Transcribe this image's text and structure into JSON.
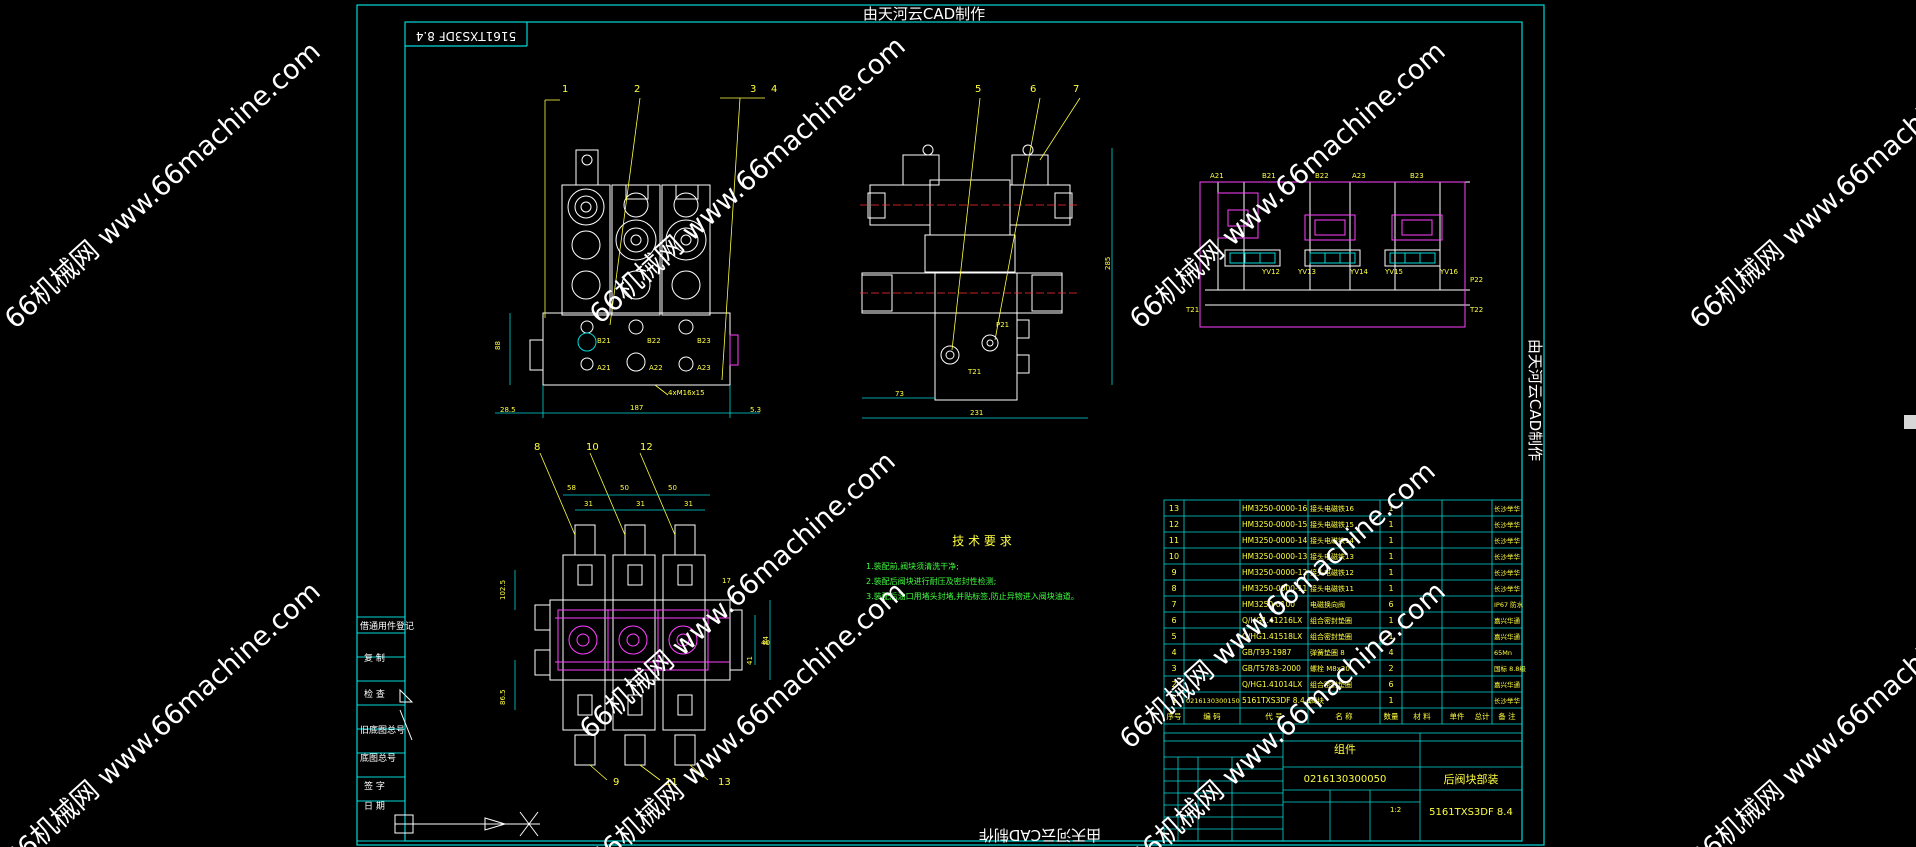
{
  "drawing": {
    "title_top": "由天河云CAD制作",
    "title_bottom": "由天河云CAD制作",
    "title_right": "由天河云CAD制作",
    "drawing_code_stamp": "5161TXS3DF 8.4"
  },
  "watermarks": [
    "66机械网 www.66machine.com",
    "66机械网 www.66machine.com",
    "66机械网 www.66machine.com",
    "66机械网 www.66machine.com",
    "66机械网 www.66machine.com",
    "66机械网 www.66machine.com",
    "66机械网 www.66machine.com",
    "66机械网 www.66machine.com",
    "66机械网 www.66machine.com",
    "66机械网 www.66machine.com"
  ],
  "left_strip": [
    "借通用件登记",
    "复 制",
    "检 查",
    "旧底图总号",
    "底图总号",
    "签 字",
    "日 期"
  ],
  "front_view": {
    "callouts": [
      "1",
      "2",
      "3",
      "4"
    ],
    "ports": [
      "B21",
      "B22",
      "B23",
      "A21",
      "A22",
      "A23"
    ],
    "bolt_label": "4xM16x15",
    "dims": [
      "28.5",
      "187",
      "5.3",
      "88"
    ]
  },
  "side_view": {
    "callouts": [
      "5",
      "6",
      "7"
    ],
    "ports": [
      "P21",
      "T21"
    ],
    "dims": [
      "73",
      "231",
      "285"
    ]
  },
  "top_view": {
    "callouts": [
      "8",
      "10",
      "12",
      "9",
      "11",
      "13"
    ],
    "dims": [
      "58",
      "31",
      "50",
      "31",
      "50",
      "31",
      "17",
      "84",
      "40",
      "41",
      "102.5",
      "86.5"
    ]
  },
  "hydraulic": {
    "ports_top": [
      "A21",
      "B21",
      "B22",
      "A23",
      "B23"
    ],
    "coils": [
      "YV12",
      "YV13",
      "YV14",
      "YV15",
      "YV16"
    ],
    "ports_side": [
      "P22",
      "T22",
      "T21"
    ]
  },
  "tech_req": {
    "title": "技 术 要 求",
    "lines": [
      "1.装配前,阀块须清洗干净;",
      "2.装配后阀块进行耐压及密封性检测;",
      "3.装配后油口用堵头封堵,并贴标签,防止异物进入阀块油道。"
    ]
  },
  "bom": {
    "rows": [
      {
        "no": "13",
        "code": "",
        "std": "HM3250-0000-16",
        "name": "接头电磁铁16",
        "qty": "1",
        "note": "长沙举华"
      },
      {
        "no": "12",
        "code": "",
        "std": "HM3250-0000-15",
        "name": "接头电磁铁15",
        "qty": "1",
        "note": "长沙举华"
      },
      {
        "no": "11",
        "code": "",
        "std": "HM3250-0000-14",
        "name": "接头电磁铁14",
        "qty": "1",
        "note": "长沙举华"
      },
      {
        "no": "10",
        "code": "",
        "std": "HM3250-0000-13",
        "name": "接头电磁铁13",
        "qty": "1",
        "note": "长沙举华"
      },
      {
        "no": "9",
        "code": "",
        "std": "HM3250-0000-12",
        "name": "接头电磁铁12",
        "qty": "1",
        "note": "长沙举华"
      },
      {
        "no": "8",
        "code": "",
        "std": "HM3250-0000-11",
        "name": "接头电磁铁11",
        "qty": "1",
        "note": "长沙举华"
      },
      {
        "no": "7",
        "code": "",
        "std": "HM3250-0100",
        "name": "电磁换向阀",
        "qty": "6",
        "note": "IP67 防水"
      },
      {
        "no": "6",
        "code": "",
        "std": "Q/HG1.41216LX",
        "name": "组合密封垫圈",
        "qty": "1",
        "note": "嘉兴华通"
      },
      {
        "no": "5",
        "code": "",
        "std": "Q/HG1.41518LX",
        "name": "组合密封垫圈",
        "qty": "1",
        "note": "嘉兴华通"
      },
      {
        "no": "4",
        "code": "",
        "std": "GB/T93-1987",
        "name": "弹簧垫圈 8",
        "qty": "4",
        "note": "65Mn"
      },
      {
        "no": "3",
        "code": "",
        "std": "GB/T5783-2000",
        "name": "螺栓 M8x20",
        "qty": "2",
        "note": "国标 8.8级"
      },
      {
        "no": "2",
        "code": "",
        "std": "Q/HG1.41014LX",
        "name": "组合密封垫圈",
        "qty": "6",
        "note": "嘉兴华通"
      },
      {
        "no": "1",
        "code": "0216130300150",
        "std": "5161TXS3DF 8.4.1",
        "name": "阀块",
        "qty": "1",
        "note": "长沙举华"
      }
    ],
    "header": [
      "序号",
      "编 码",
      "代 号",
      "名 称",
      "数量",
      "材 料",
      "单件",
      "总计",
      "备 注"
    ]
  },
  "title_block": {
    "type": "组件",
    "drawing_no": "0216130300050",
    "part_name": "后阀块部装",
    "part_code": "5161TXS3DF 8.4",
    "scale": "1:2"
  }
}
